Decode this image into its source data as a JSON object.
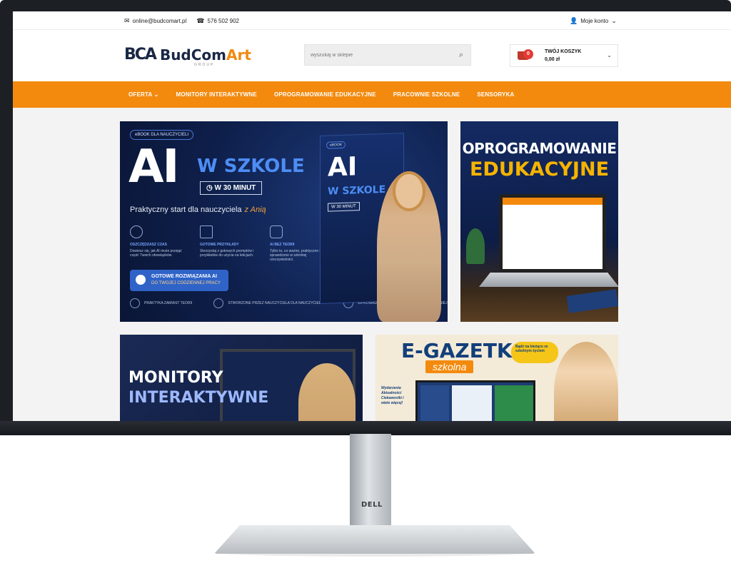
{
  "device": {
    "brand_logo": "DELL"
  },
  "topbar": {
    "email": "online@budcomart.pl",
    "phone": "576 502 902",
    "account_label": "Moje konto"
  },
  "header": {
    "logo_mark": "BCA",
    "logo_name_main": "BudCom",
    "logo_name_accent": "Art",
    "logo_sub": "GROUP",
    "search_placeholder": "wyszukaj w sklepie",
    "cart_badge": "0",
    "cart_title": "TWÓJ KOSZYK",
    "cart_value": "0,00 zł"
  },
  "nav": {
    "items": [
      "OFERTA",
      "MONITORY INTERAKTYWNE",
      "OPROGRAMOWANIE EDUKACYJNE",
      "PRACOWNIE SZKOLNE",
      "SENSORYKA"
    ]
  },
  "banners": {
    "ai": {
      "pill": "eBOOK DLA NAUCZYCIELI",
      "title_big": "AI",
      "title_w_szkole": "W SZKOLE",
      "minutes": "W 30 MINUT",
      "subtitle": "Praktyczny start dla nauczyciela",
      "signature": "z Anią",
      "features": [
        {
          "title": "OSZCZĘDZASZ CZAS",
          "text": "Dowiesz się, jak AI może przejąć część Twoich obowiązków."
        },
        {
          "title": "GOTOWE PRZYKŁADY",
          "text": "Skorzystaj z gotowych promptów i przykładów do użycia na lekcjach."
        },
        {
          "title": "AI BEZ TEORII",
          "text": "Tylko to, co ważne, praktyczne i sprawdzone w szkolnej rzeczywistości."
        }
      ],
      "cta_line1": "GOTOWE ROZWIĄZANIA AI",
      "cta_line2": "DO TWOJEJ CODZIENNEJ PRACY",
      "footer": [
        "PRAKTYKA ZAMIAST TEORII",
        "STWORZONE PRZEZ NAUCZYCIELA DLA NAUCZYCIELI",
        "WPROWADŹ AI DO SZKOŁY I DZIAŁAJ SKUTECZNIEJ"
      ],
      "book_label": "eBOOK",
      "book_title": "AI",
      "book_sub": "W SZKOLE",
      "book_minutes": "W 30 MINUT"
    },
    "software": {
      "line1": "OPROGRAMOWANIE",
      "line2": "EDUKACYJNE"
    },
    "monitors": {
      "line1": "MONITORY",
      "line2": "INTERAKTYWNE"
    },
    "gazette": {
      "title": "E-GAZETKA",
      "subtitle": "szkolna",
      "side_text": "Wydarzenia Aktualności Ciekawostki i wiele więcej!",
      "bubble": "Bądź na bieżąco ze szkolnym życiem"
    }
  }
}
